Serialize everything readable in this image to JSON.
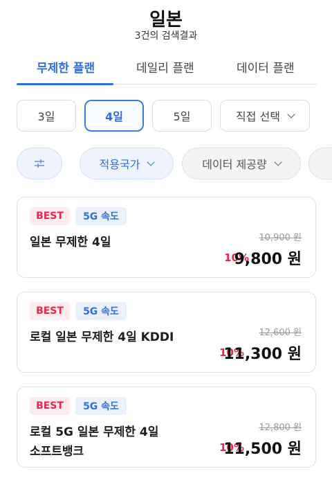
{
  "header": {
    "title": "일본",
    "result_count": "3건의 검색결과"
  },
  "tabs": [
    {
      "label": "무제한 플랜",
      "active": true
    },
    {
      "label": "데일리 플랜",
      "active": false
    },
    {
      "label": "데이터 플랜",
      "active": false
    }
  ],
  "day_filter": {
    "options": [
      "3일",
      "4일",
      "5일"
    ],
    "selected": "4일",
    "custom_label": "직접 선택"
  },
  "filters": {
    "settings_icon": "sliders-icon",
    "country": "적용국가",
    "data_amount": "데이터 제공량"
  },
  "colors": {
    "accent": "#2f6fdb",
    "discount": "#e0294c"
  },
  "products": [
    {
      "badge_best": "BEST",
      "badge_speed": "5G 속도",
      "name_line1": "일본 무제한 4일",
      "name_line2": "",
      "original_price": "10,900 원",
      "discount": "10%",
      "price": "9,800 원"
    },
    {
      "badge_best": "BEST",
      "badge_speed": "5G 속도",
      "name_line1": "로컬 일본 무제한 4일 KDDI",
      "name_line2": "",
      "original_price": "12,600 원",
      "discount": "10%",
      "price": "11,300 원"
    },
    {
      "badge_best": "BEST",
      "badge_speed": "5G 속도",
      "name_line1": "로컬 5G 일본 무제한 4일",
      "name_line2": "소프트뱅크",
      "original_price": "12,800 원",
      "discount": "10%",
      "price": "11,500 원"
    }
  ]
}
